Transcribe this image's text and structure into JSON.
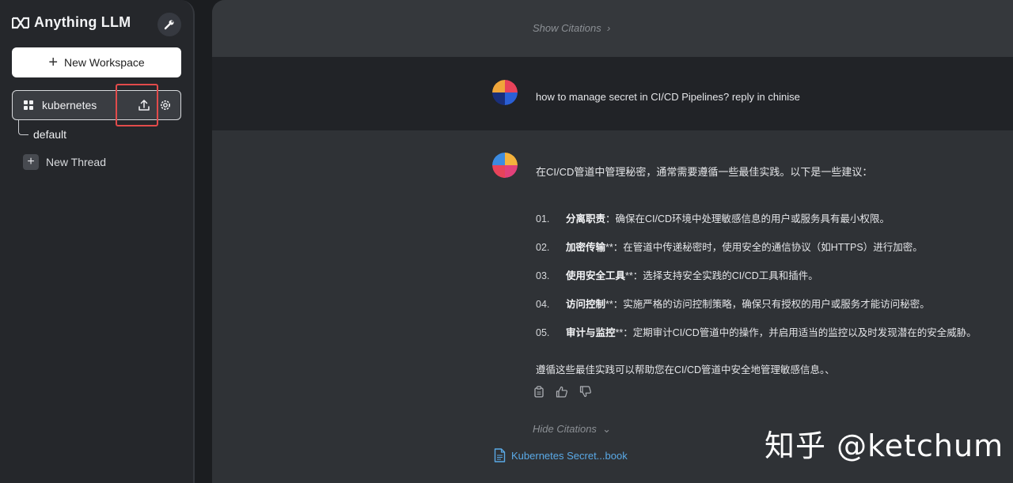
{
  "app": {
    "name": "Anything LLM"
  },
  "sidebar": {
    "new_workspace_label": "New Workspace",
    "workspace": {
      "name": "kubernetes"
    },
    "threads": [
      {
        "label": "default"
      }
    ],
    "new_thread_label": "New Thread"
  },
  "chat": {
    "show_citations": "Show Citations",
    "user_message": "how to manage secret in CI/CD Pipelines? reply in chinise",
    "reply": {
      "intro": "在CI/CD管道中管理秘密，通常需要遵循一些最佳实践。以下是一些建议：",
      "items": [
        {
          "num": "01.",
          "bold": "分离职责",
          "text": "：确保在CI/CD环境中处理敏感信息的用户或服务具有最小权限。"
        },
        {
          "num": "02.",
          "bold": "加密传输",
          "text": "**：在管道中传递秘密时，使用安全的通信协议（如HTTPS）进行加密。"
        },
        {
          "num": "03.",
          "bold": "使用安全工具",
          "text": "**：选择支持安全实践的CI/CD工具和插件。"
        },
        {
          "num": "04.",
          "bold": "访问控制",
          "text": "**：实施严格的访问控制策略，确保只有授权的用户或服务才能访问秘密。"
        },
        {
          "num": "05.",
          "bold": "审计与监控",
          "text": "**：定期审计CI/CD管道中的操作，并启用适当的监控以及时发现潜在的安全威胁。"
        }
      ],
      "outro": "遵循这些最佳实践可以帮助您在CI/CD管道中安全地管理敏感信息。、"
    },
    "hide_citations": "Hide Citations",
    "citation_source": "Kubernetes Secret...book"
  },
  "watermark": "知乎 @ketchum",
  "colors": {
    "highlight": "#e24b4b",
    "link": "#5aa9e6"
  }
}
